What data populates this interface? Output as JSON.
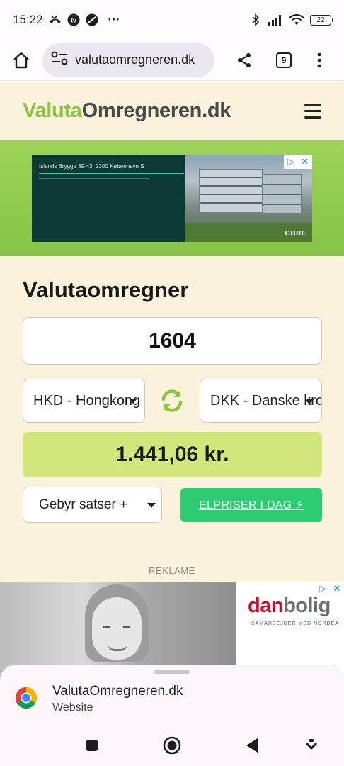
{
  "status_bar": {
    "time": "15:22",
    "more_indicator": "···",
    "battery": "22",
    "icons": [
      "missed-call-icon",
      "tv-icon",
      "app-icon",
      "bluetooth-icon",
      "signal-icon",
      "wifi-icon",
      "battery-icon"
    ]
  },
  "browser": {
    "url": "valutaomregneren.dk",
    "tab_count": "9",
    "icons": [
      "home-icon",
      "site-settings-icon",
      "share-icon",
      "tabs-icon",
      "more-vert-icon"
    ]
  },
  "site": {
    "logo_part1": "Valuta",
    "logo_part2": "Omregneren.dk",
    "menu_icon": "hamburger-menu-icon",
    "colors": {
      "logo_green": "#8cc63f",
      "logo_dark": "#4a4a4a",
      "page_bg": "#fbf2dc",
      "result_bg": "#d1e77c",
      "button_green": "#2ecc71"
    }
  },
  "ad_top": {
    "address": "Islands Brygge 39-43, 2300 København S",
    "brand": "CBRE"
  },
  "converter": {
    "title": "Valutaomregner",
    "amount": "1604",
    "from_currency": "HKD - Hongkong",
    "to_currency": "DKK - Danske kro",
    "result": "1.441,06 kr.",
    "fee_label": "Gebyr satser +",
    "elpriser_button": "ELPRISER I DAG ⚡",
    "swap_icon": "swap-refresh-icon"
  },
  "reklame_label": "REKLAME",
  "ad_bottom": {
    "brand_part1": "dan",
    "brand_part2": "bolig",
    "tagline": "SAMARBEJDER MED NORDEA"
  },
  "bottom_sheet": {
    "title": "ValutaOmregneren.dk",
    "subtitle": "Website",
    "icon": "chrome-icon"
  },
  "nav": {
    "icons": [
      "recents-square-icon",
      "home-circle-icon",
      "back-triangle-icon",
      "keyboard-hide-icon"
    ]
  }
}
